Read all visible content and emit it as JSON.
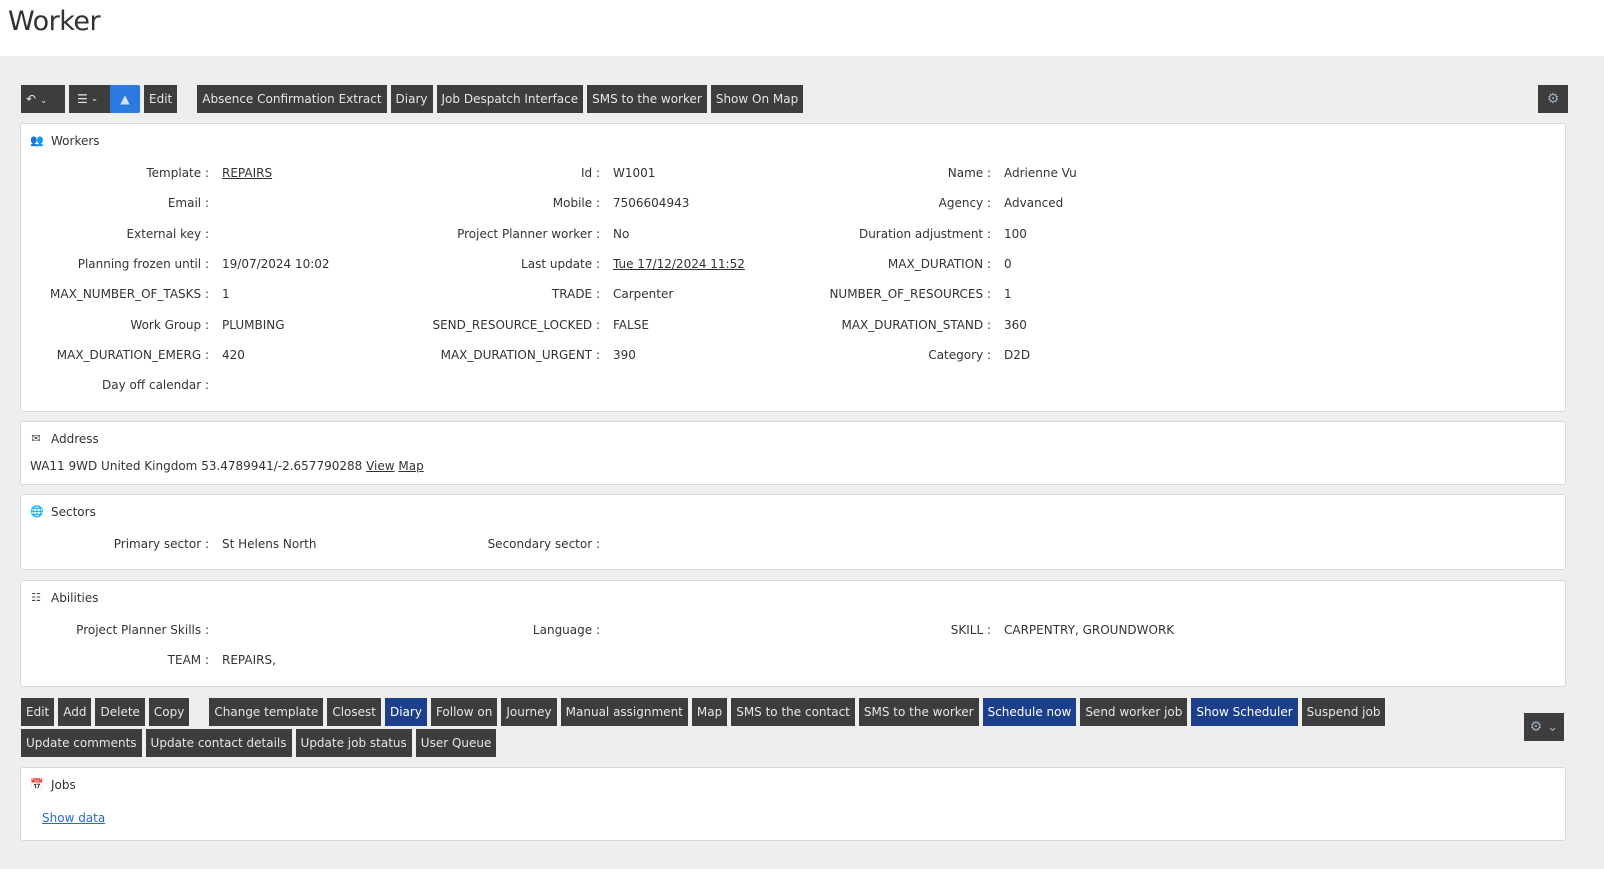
{
  "page_title": "Worker",
  "toolbar": {
    "edit": "Edit",
    "buttons": [
      "Absence Confirmation Extract",
      "Diary",
      "Job Despatch Interface",
      "SMS to the worker",
      "Show On Map"
    ]
  },
  "workers": {
    "title": "Workers",
    "rows": [
      [
        [
          "Template :",
          "REPAIRS"
        ],
        [
          "Id :",
          "W1001"
        ],
        [
          "Name :",
          "Adrienne Vu"
        ]
      ],
      [
        [
          "Email :",
          ""
        ],
        [
          "Mobile :",
          "7506604943"
        ],
        [
          "Agency :",
          "Advanced"
        ]
      ],
      [
        [
          "External key :",
          ""
        ],
        [
          "Project Planner worker :",
          "No"
        ],
        [
          "Duration adjustment :",
          "100"
        ]
      ],
      [
        [
          "Planning frozen until :",
          "19/07/2024 10:02"
        ],
        [
          "Last update :",
          "Tue 17/12/2024 11:52"
        ],
        [
          "MAX_DURATION :",
          "0"
        ]
      ],
      [
        [
          "MAX_NUMBER_OF_TASKS :",
          "1"
        ],
        [
          "TRADE :",
          "Carpenter"
        ],
        [
          "NUMBER_OF_RESOURCES :",
          "1"
        ]
      ],
      [
        [
          "Work Group :",
          "PLUMBING"
        ],
        [
          "SEND_RESOURCE_LOCKED :",
          "FALSE"
        ],
        [
          "MAX_DURATION_STAND :",
          "360"
        ]
      ],
      [
        [
          "MAX_DURATION_EMERG :",
          "420"
        ],
        [
          "MAX_DURATION_URGENT :",
          "390"
        ],
        [
          "Category :",
          "D2D"
        ]
      ],
      [
        [
          "Day off calendar :",
          ""
        ]
      ]
    ]
  },
  "address": {
    "title": "Address",
    "text": "WA11 9WD United Kingdom 53.4789941/-2.657790288",
    "view": "View",
    "map": "Map"
  },
  "sectors": {
    "title": "Sectors",
    "rows": [
      [
        [
          "Primary sector :",
          "St Helens North"
        ],
        [
          "Secondary sector :",
          ""
        ]
      ]
    ]
  },
  "abilities": {
    "title": "Abilities",
    "rows": [
      [
        [
          "Project Planner Skills :",
          ""
        ],
        [
          "Language :",
          ""
        ],
        [
          "SKILL :",
          "CARPENTRY, GROUNDWORK"
        ]
      ],
      [
        [
          "TEAM :",
          "REPAIRS,"
        ]
      ]
    ]
  },
  "actions": {
    "group1": [
      "Edit",
      "Add",
      "Delete",
      "Copy"
    ],
    "group2": [
      "Change template",
      "Closest",
      "Diary",
      "Follow on",
      "Journey",
      "Manual assignment",
      "Map",
      "SMS to the contact",
      "SMS to the worker",
      "Schedule now",
      "Send worker job",
      "Show Scheduler",
      "Suspend job",
      "Update comments",
      "Update contact details",
      "Update job status",
      "User Queue"
    ],
    "highlighted": [
      "Diary",
      "Schedule now",
      "Show Scheduler"
    ]
  },
  "jobs": {
    "title": "Jobs",
    "show_data": "Show data"
  }
}
